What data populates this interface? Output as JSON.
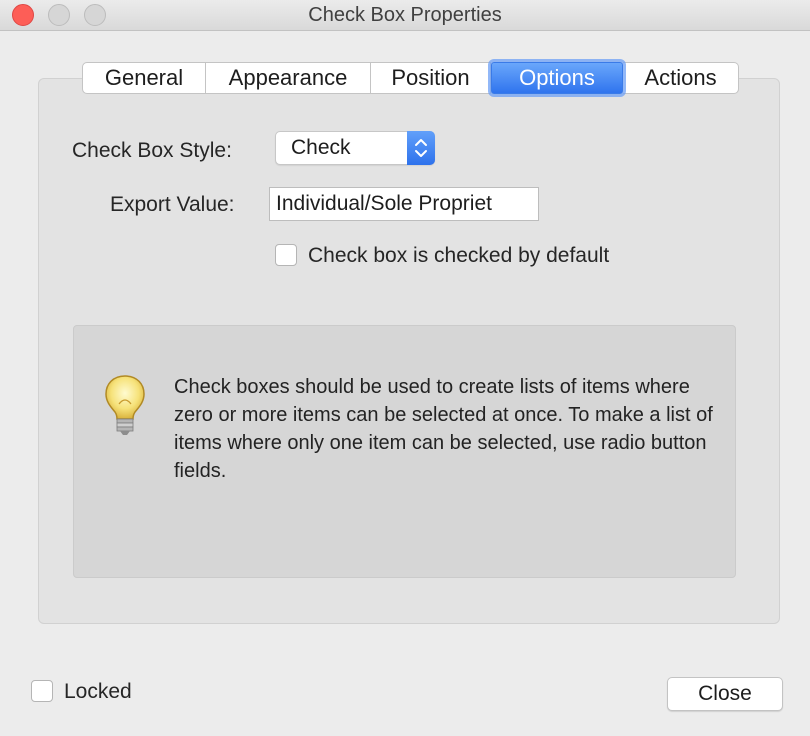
{
  "window": {
    "title": "Check Box Properties"
  },
  "tabs": [
    {
      "label": "General"
    },
    {
      "label": "Appearance"
    },
    {
      "label": "Position"
    },
    {
      "label": "Options",
      "active": true
    },
    {
      "label": "Actions"
    }
  ],
  "options": {
    "style_label": "Check Box Style:",
    "style_value": "Check",
    "export_label": "Export Value:",
    "export_value": "Individual/Sole Propriet",
    "default_checked_label": "Check box is checked by default",
    "default_checked": false
  },
  "info": {
    "icon": "lightbulb-icon",
    "text": "Check boxes should be used to create lists of items where zero or more items can be selected at once. To make a list of items where only one item can be selected, use radio button fields."
  },
  "footer": {
    "locked_label": "Locked",
    "locked": false,
    "close_label": "Close"
  },
  "colors": {
    "accent": "#2f74ee",
    "close_light": "#fd5e57"
  }
}
